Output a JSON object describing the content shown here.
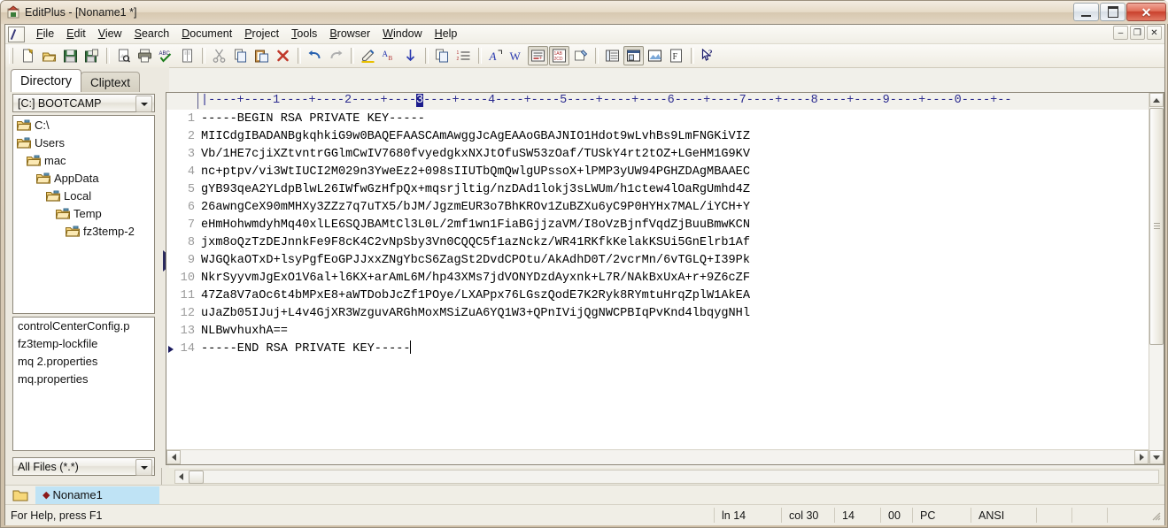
{
  "window": {
    "title": "EditPlus - [Noname1 *]",
    "app_icon": "editplus-app-icon",
    "buttons": {
      "minimize": "–",
      "maximize": "□",
      "close": "✕"
    }
  },
  "mdi_buttons": {
    "minimize": "–",
    "restore": "❐",
    "close": "✕"
  },
  "menu": [
    {
      "label": "File",
      "accel": "F"
    },
    {
      "label": "Edit",
      "accel": "E"
    },
    {
      "label": "View",
      "accel": "V"
    },
    {
      "label": "Search",
      "accel": "S"
    },
    {
      "label": "Document",
      "accel": "D"
    },
    {
      "label": "Project",
      "accel": "P"
    },
    {
      "label": "Tools",
      "accel": "T"
    },
    {
      "label": "Browser",
      "accel": "B"
    },
    {
      "label": "Window",
      "accel": "W"
    },
    {
      "label": "Help",
      "accel": "H"
    }
  ],
  "toolbar": {
    "groups": [
      [
        "new-file-icon",
        "open-file-icon",
        "save-icon",
        "save-all-icon"
      ],
      [
        "print-preview-icon",
        "print-icon",
        "spell-check-icon",
        "page-setup-icon"
      ],
      [
        "cut-icon",
        "copy-icon",
        "paste-icon",
        "delete-icon"
      ],
      [
        "undo-icon",
        "redo-icon"
      ],
      [
        "highlight-icon",
        "find-icon",
        "find-next-icon"
      ],
      [
        "duplicate-line-icon",
        "line-numbers-icon"
      ],
      [
        "font-icon",
        "word-wrap-icon",
        "show-spaces-icon",
        "column-mode-icon",
        "user-tools-icon"
      ],
      [
        "document-selector-icon",
        "output-window-icon",
        "browser-preview-icon",
        "function-list-icon"
      ],
      [
        "help-pointer-icon"
      ]
    ],
    "pressed": [
      "show-spaces-icon",
      "column-mode-icon",
      "output-window-icon"
    ]
  },
  "sidebar": {
    "tabs": [
      {
        "label": "Directory",
        "active": true
      },
      {
        "label": "Cliptext",
        "active": false
      }
    ],
    "drive_combo": {
      "value": "[C:] BOOTCAMP"
    },
    "tree": [
      {
        "label": "C:\\",
        "depth": 0
      },
      {
        "label": "Users",
        "depth": 0
      },
      {
        "label": "mac",
        "depth": 1
      },
      {
        "label": "AppData",
        "depth": 2
      },
      {
        "label": "Local",
        "depth": 3
      },
      {
        "label": "Temp",
        "depth": 4
      },
      {
        "label": "fz3temp-2",
        "depth": 5
      }
    ],
    "files": [
      "controlCenterConfig.p",
      "fz3temp-lockfile",
      "mq 2.properties",
      "mq.properties"
    ],
    "filter_combo": {
      "value": "All Files (*.*)"
    }
  },
  "editor": {
    "ruler": "|----+----1----+----2----+----",
    "ruler_highlight": "3",
    "ruler_after": "----+----4----+----5----+----+----6----+----7----+----8----+----9----+----0----+--",
    "line_numbers": [
      "1",
      "2",
      "3",
      "4",
      "5",
      "6",
      "7",
      "8",
      "9",
      "10",
      "11",
      "12",
      "13",
      "14"
    ],
    "current_line_index": 13,
    "lines": [
      "-----BEGIN RSA PRIVATE KEY-----",
      "MIICdgIBADANBgkqhkiG9w0BAQEFAASCAmAwggJcAgEAAoGBAJNIO1Hdot9wLvhBs9LmFNGKiVIZ",
      "Vb/1HE7cjiXZtvntrGGlmCwIV7680fvyedgkxNXJtOfuSW53zOaf/TUSkY4rt2tOZ+LGeHM1G9KV",
      "nc+ptpv/vi3WtIUCI2M029n3YweEz2+098sIIUTbQmQwlgUPssoX+lPMP3yUW94PGHZDAgMBAAEC",
      "gYB93qeA2YLdpBlwL26IWfwGzHfpQx+mqsrjltig/nzDAd1lokj3sLWUm/h1ctew4lOaRgUmhd4Z",
      "26awngCeX90mMHXy3ZZz7q7uTX5/bJM/JgzmEUR3o7BhKROv1ZuBZXu6yC9P0HYHx7MAL/iYCH+Y",
      "eHmHohwmdyhMq40xlLE6SQJBAMtCl3L0L/2mf1wn1FiaBGjjzaVM/I8oVzBjnfVqdZjBuuBmwKCN",
      "jxm8oQzTzDEJnnkFe9F8cK4C2vNpSby3Vn0CQQC5f1azNckz/WR41RKfkKelakKSUi5GnElrb1Af",
      "WJGQkaOTxD+lsyPgfEoGPJJxxZNgYbcS6ZagSt2DvdCPOtu/AkAdhD0T/2vcrMn/6vTGLQ+I39Pk",
      "NkrSyyvmJgExO1V6al+l6KX+arAmL6M/hp43XMs7jdVONYDzdAyxnk+L7R/NAkBxUxA+r+9Z6cZF",
      "47Za8V7aOc6t4bMPxE8+aWTDobJcZf1POye/LXAPpx76LGszQodE7K2Ryk8RYmtuHrqZplW1AkEA",
      "uJaZb05IJuj+L4v4GjXR3WzguvARGhMoxMSiZuA6YQ1W3+QPnIVijQgNWCPBIqPvKnd4lbqygNHl",
      "NLBwvhuxhA==",
      "-----END RSA PRIVATE KEY-----"
    ]
  },
  "doc_tabs": [
    {
      "label": "Noname1",
      "modified": true,
      "active": true
    }
  ],
  "statusbar": {
    "help": "For Help, press F1",
    "line": "ln 14",
    "col": "col 30",
    "chars": "14",
    "sel": "00",
    "eol": "PC",
    "encoding": "ANSI"
  },
  "colors": {
    "accent": "#1c1c8c",
    "tab_active": "#bfe3f5",
    "ruler_text": "#2b2b8f",
    "line_number": "#9b9b9b",
    "close_button": "#c9402c"
  }
}
